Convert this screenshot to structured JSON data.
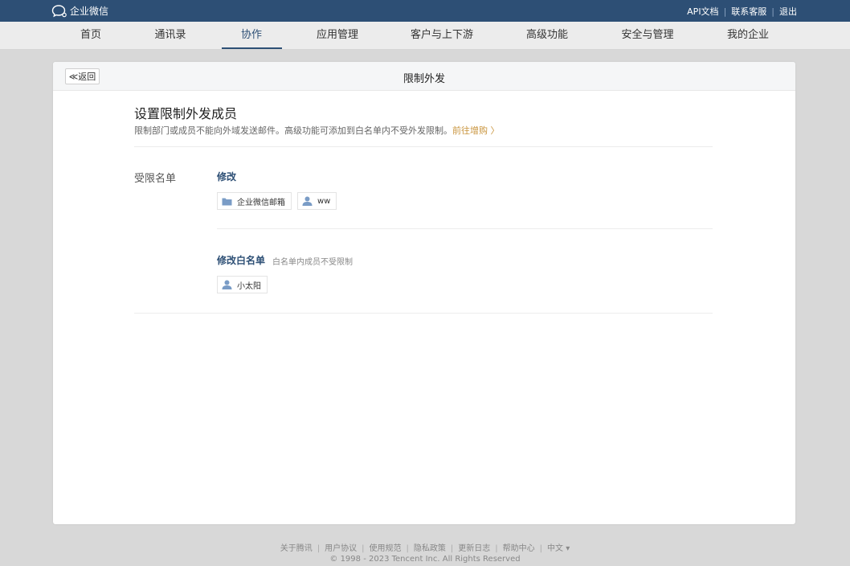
{
  "topbar": {
    "logo_text": "企业微信",
    "links": [
      "API文档",
      "联系客服",
      "退出"
    ]
  },
  "nav": {
    "tabs": [
      "首页",
      "通讯录",
      "协作",
      "应用管理",
      "客户与上下游",
      "高级功能",
      "安全与管理",
      "我的企业"
    ],
    "active": "协作"
  },
  "card": {
    "back_label": "≪返回",
    "title": "限制外发",
    "section_title": "设置限制外发成员",
    "section_desc": "限制部门或成员不能向外域发送邮件。高级功能可添加到白名单内不受外发限制。",
    "upgrade_link": "前往增购 〉",
    "restricted": {
      "label": "受限名单",
      "edit": "修改",
      "chips": [
        {
          "icon": "folder-icon",
          "text": "企业微信邮箱"
        },
        {
          "icon": "user-icon",
          "text": "ww"
        }
      ]
    },
    "whitelist": {
      "edit": "修改白名单",
      "hint": "白名单内成员不受限制",
      "chips": [
        {
          "icon": "user-icon",
          "text": "小太阳"
        }
      ]
    }
  },
  "footer": {
    "links": [
      "关于腾讯",
      "用户协议",
      "使用规范",
      "隐私政策",
      "更新日志",
      "帮助中心"
    ],
    "language": "中文 ▾",
    "copyright": "© 1998 - 2023 Tencent Inc. All Rights Reserved"
  },
  "colors": {
    "topbar": "#2d4f75",
    "accent": "#2d4f75",
    "upgrade": "#c9943d",
    "icon": "#7a9cc6"
  }
}
